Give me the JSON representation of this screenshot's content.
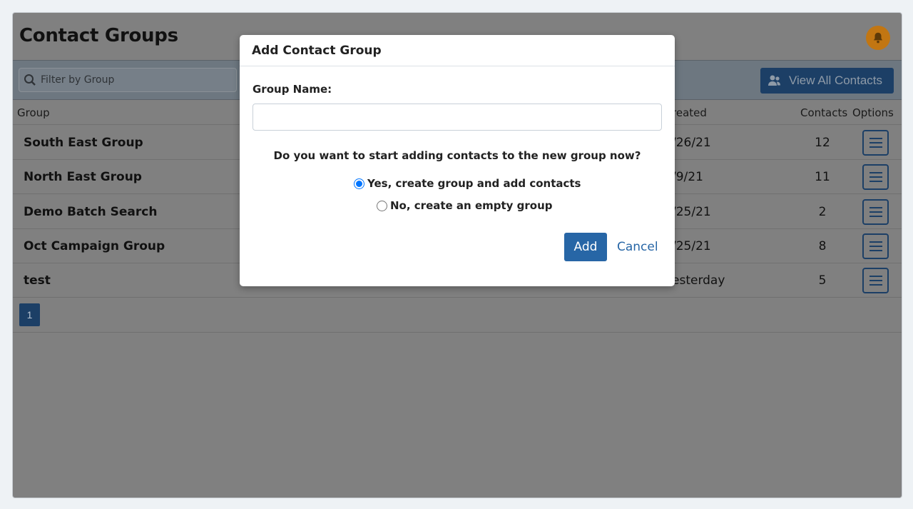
{
  "page": {
    "title": "Contact Groups",
    "notification_icon": "bell-icon"
  },
  "toolbar": {
    "filter_placeholder": "Filter by Group",
    "view_all_label": "View All Contacts"
  },
  "table": {
    "headers": {
      "group": "Group",
      "created": "reated",
      "contacts": "Contacts",
      "options": "Options"
    },
    "rows": [
      {
        "group": "South East Group",
        "created": "/26/21",
        "contacts": "12"
      },
      {
        "group": "North East Group",
        "created": "/9/21",
        "contacts": "11"
      },
      {
        "group": "Demo Batch Search",
        "created": "/25/21",
        "contacts": "2"
      },
      {
        "group": "Oct Campaign Group",
        "created": "/25/21",
        "contacts": "8"
      },
      {
        "group": "test",
        "created": "esterday",
        "contacts": "5"
      }
    ]
  },
  "pagination": {
    "current": "1"
  },
  "modal": {
    "title": "Add Contact Group",
    "group_name_label": "Group Name:",
    "group_name_value": "",
    "question": "Do you want to start adding contacts to the new group now?",
    "options": [
      {
        "label": "Yes, create group and add contacts",
        "selected": true
      },
      {
        "label": "No, create an empty group",
        "selected": false
      }
    ],
    "add_label": "Add",
    "cancel_label": "Cancel"
  },
  "colors": {
    "primary": "#2766a6",
    "notification": "#f39c1f"
  }
}
